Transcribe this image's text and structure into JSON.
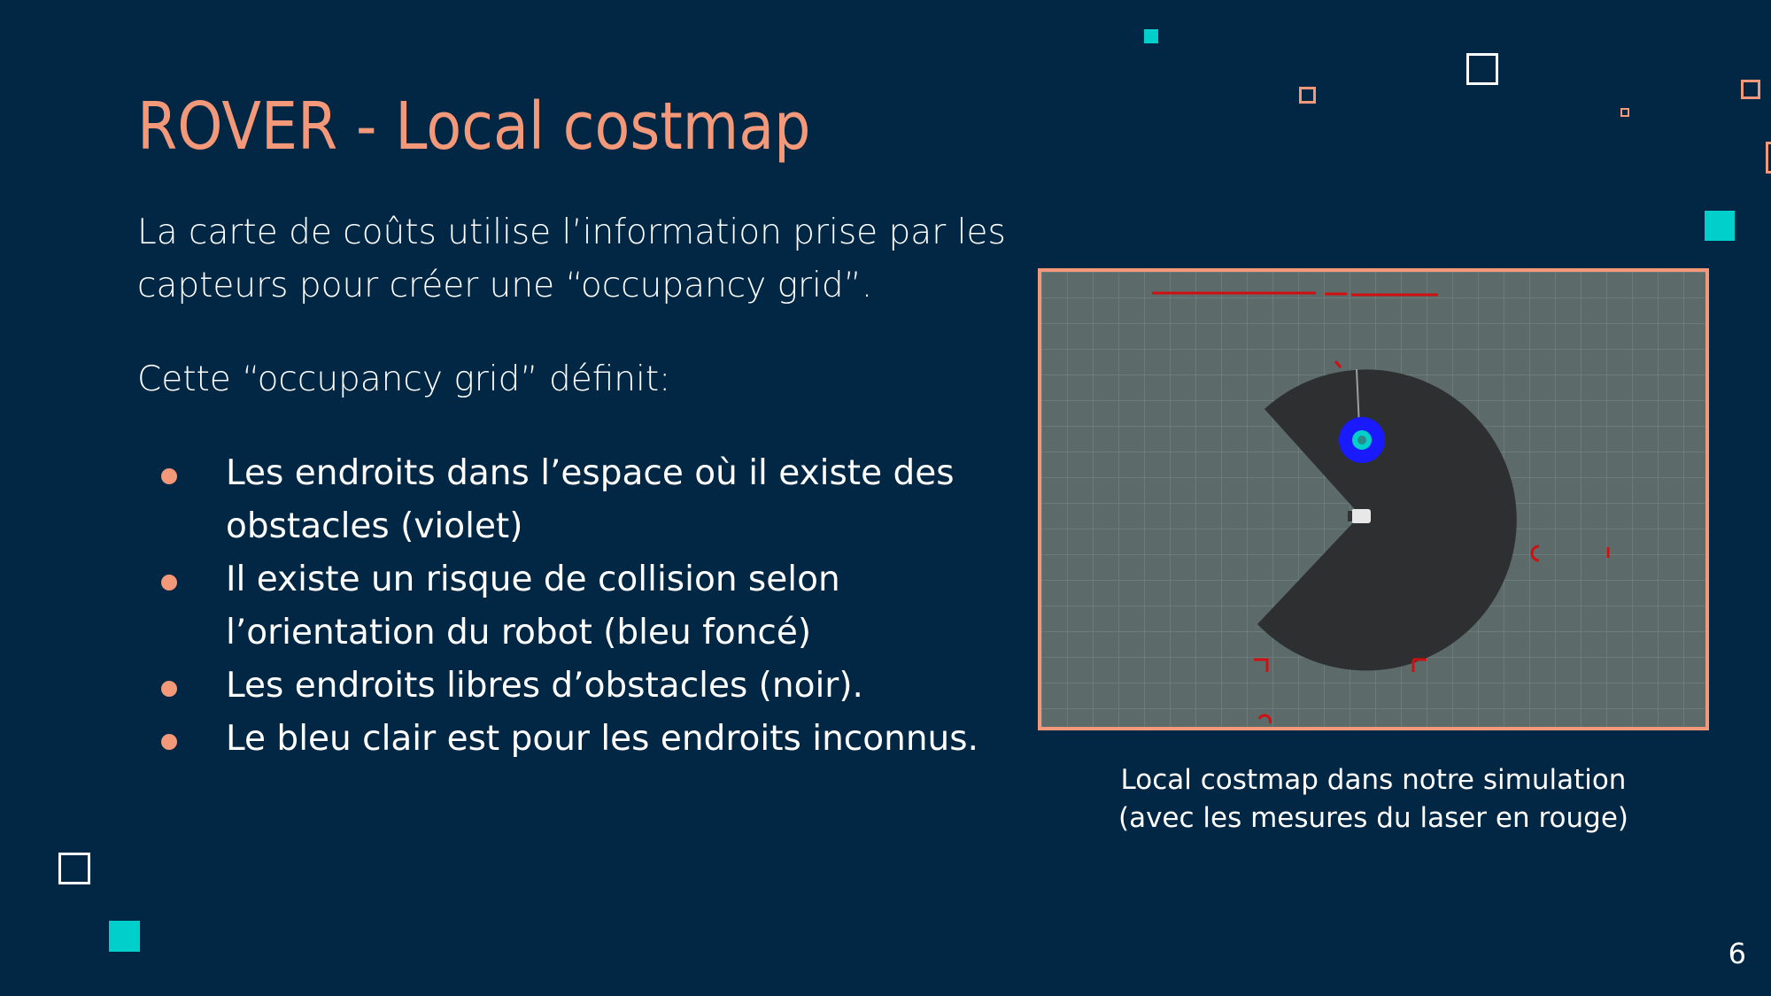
{
  "slide": {
    "title": "ROVER - Local costmap",
    "paragraph1": "La carte de coûts utilise l’information prise par les capteurs pour créer une “occupancy grid”.",
    "paragraph2": "Cette “occupancy grid” définit:",
    "bullets": [
      "Les endroits dans l’espace où il existe des obstacles (violet)",
      "Il existe un risque de collision selon l’orientation du robot (bleu foncé)",
      "Les endroits libres d’obstacles (noir).",
      "Le bleu clair est pour les endroits inconnus."
    ],
    "caption_line1": "Local costmap dans notre simulation",
    "caption_line2": "(avec les mesures du laser en rouge)",
    "page_number": "6"
  },
  "colors": {
    "background": "#012744",
    "accent_orange": "#f4987a",
    "accent_teal": "#00cfcb",
    "costmap_grid": "#5c6a6a",
    "free_space": "#2e2f30",
    "laser": "#d01010",
    "inflation": "#1a1aff"
  }
}
